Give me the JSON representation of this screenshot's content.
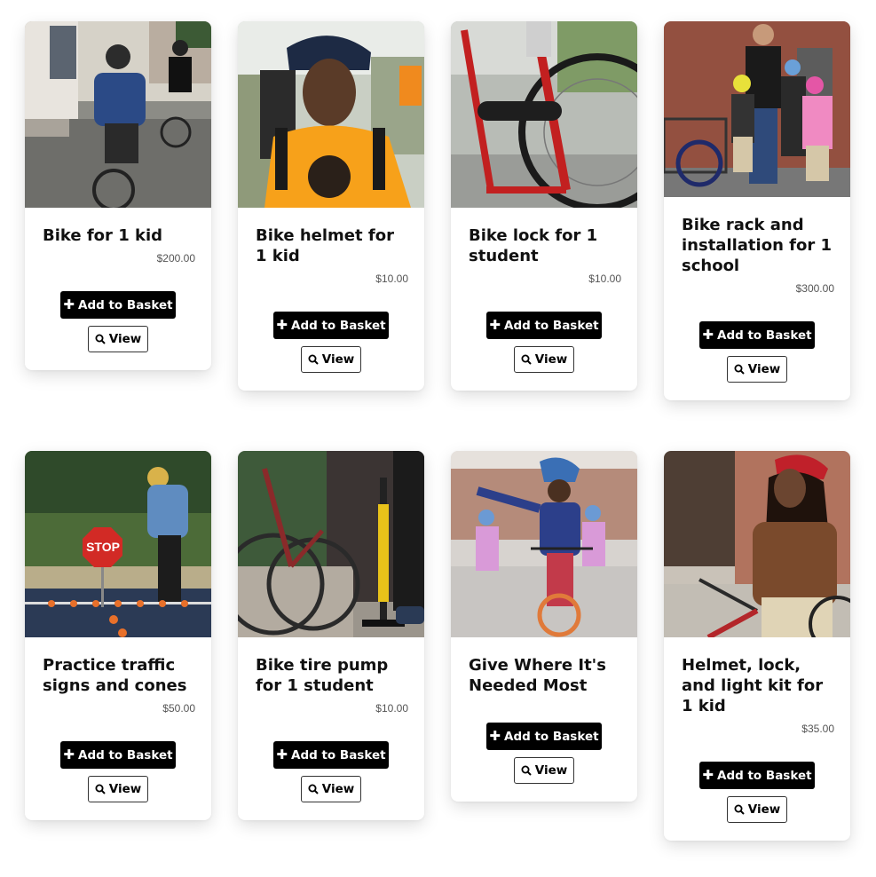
{
  "products": [
    {
      "title": "Bike for 1 kid",
      "price": "$200.00",
      "add_label": "Add to Basket",
      "view_label": "View",
      "image": "kid-riding-bike-photo"
    },
    {
      "title": "Bike helmet for 1 kid",
      "price": "$10.00",
      "add_label": "Add to Basket",
      "view_label": "View",
      "image": "kid-in-helmet-photo"
    },
    {
      "title": "Bike lock for 1 student",
      "price": "$10.00",
      "add_label": "Add to Basket",
      "view_label": "View",
      "image": "red-bike-lock-photo"
    },
    {
      "title": "Bike rack and installation for 1 school",
      "price": "$300.00",
      "add_label": "Add to Basket",
      "view_label": "View",
      "image": "family-at-bike-rack-photo"
    },
    {
      "title": "Practice traffic signs and cones",
      "price": "$50.00",
      "add_label": "Add to Basket",
      "view_label": "View",
      "image": "stop-sign-cones-photo"
    },
    {
      "title": "Bike tire pump for 1 student",
      "price": "$10.00",
      "add_label": "Add to Basket",
      "view_label": "View",
      "image": "tire-pump-photo"
    },
    {
      "title": "Give Where It's Needed Most",
      "price": "",
      "add_label": "Add to Basket",
      "view_label": "View",
      "image": "kids-riding-group-photo"
    },
    {
      "title": "Helmet, lock, and light kit for 1 kid",
      "price": "$35.00",
      "add_label": "Add to Basket",
      "view_label": "View",
      "image": "girl-with-bike-photo"
    }
  ],
  "icons": {
    "add": "plus-icon",
    "view": "search-icon"
  },
  "colors": {
    "button_bg": "#000000",
    "button_text": "#ffffff",
    "text": "#111111",
    "price": "#555555"
  }
}
